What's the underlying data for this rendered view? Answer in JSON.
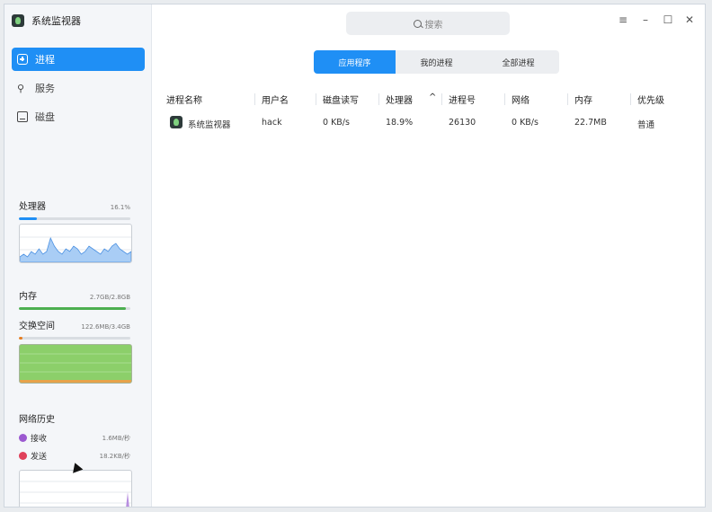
{
  "app": {
    "title": "系统监视器"
  },
  "sidebar": {
    "nav": [
      {
        "label": "进程",
        "icon": "process-icon",
        "active": true
      },
      {
        "label": "服务",
        "icon": "service-icon",
        "active": false
      },
      {
        "label": "磁盘",
        "icon": "disk-icon",
        "active": false
      }
    ],
    "cpu": {
      "label": "处理器",
      "value": "16.1%",
      "percent": 16.1,
      "history": [
        2,
        3,
        2,
        4,
        3,
        5,
        3,
        4,
        9,
        6,
        4,
        3,
        5,
        4,
        6,
        5,
        3,
        4,
        6,
        5,
        4,
        3,
        5,
        4,
        6,
        7,
        5,
        4,
        3,
        4
      ]
    },
    "memory": {
      "label": "内存",
      "value": "2.7GB/2.8GB",
      "percent": 96
    },
    "swap": {
      "label": "交换空间",
      "value": "122.6MB/3.4GB",
      "percent": 3.6
    },
    "network": {
      "title": "网络历史",
      "receive": {
        "label": "接收",
        "value": "1.6MB/秒"
      },
      "send": {
        "label": "发送",
        "value": "18.2KB/秒"
      }
    }
  },
  "search": {
    "placeholder": "搜索"
  },
  "tabs": [
    "应用程序",
    "我的进程",
    "全部进程"
  ],
  "table": {
    "columns": [
      "进程名称",
      "用户名",
      "磁盘读写",
      "处理器",
      "进程号",
      "网络",
      "内存",
      "优先级"
    ],
    "sort_indicator": "^",
    "rows": [
      {
        "name": "系统监视器",
        "user": "hack",
        "disk": "0 KB/s",
        "cpu": "18.9%",
        "pid": "26130",
        "net": "0 KB/s",
        "mem": "22.7MB",
        "priority": "普通"
      }
    ]
  },
  "colors": {
    "accent": "#1f8ff5",
    "receive": "#9b59d0",
    "send": "#e0405a",
    "memory": "#4caf50",
    "swap": "#e67e22"
  },
  "window_controls": [
    "menu-icon",
    "minimize-icon",
    "maximize-icon",
    "close-icon"
  ]
}
